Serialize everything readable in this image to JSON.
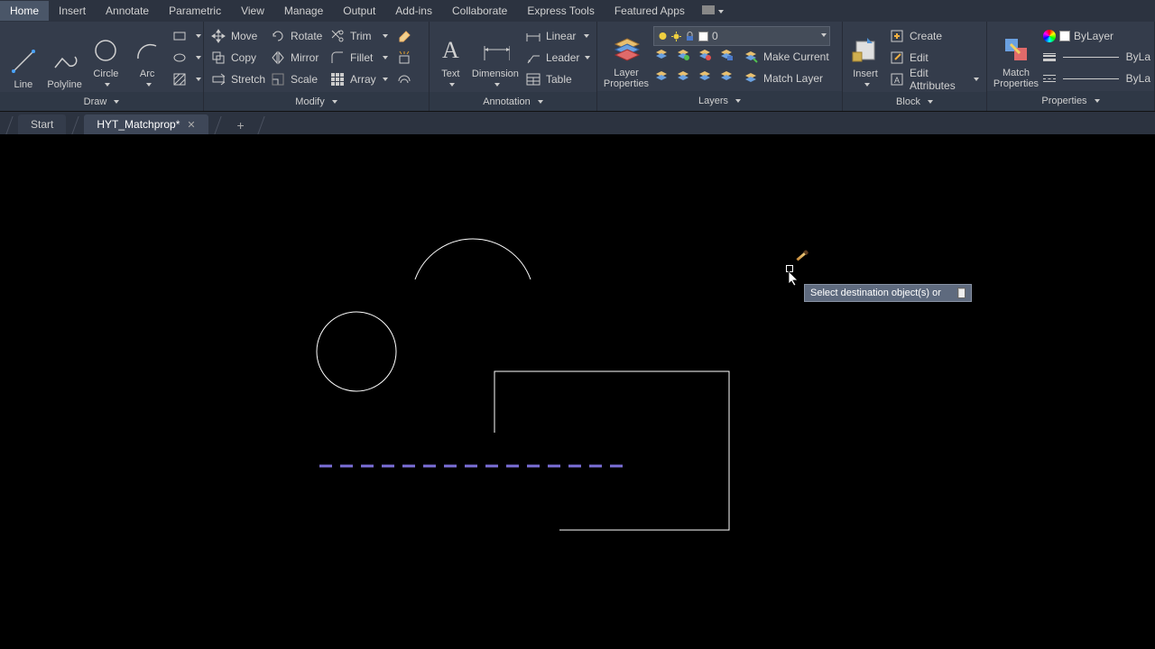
{
  "menu": {
    "tabs": [
      "Home",
      "Insert",
      "Annotate",
      "Parametric",
      "View",
      "Manage",
      "Output",
      "Add-ins",
      "Collaborate",
      "Express Tools",
      "Featured Apps"
    ]
  },
  "ribbon": {
    "draw": {
      "title": "Draw",
      "big": [
        "Line",
        "Polyline",
        "Circle",
        "Arc"
      ]
    },
    "modify": {
      "title": "Modify",
      "items": [
        [
          "Move",
          "Rotate",
          "Trim"
        ],
        [
          "Copy",
          "Mirror",
          "Fillet"
        ],
        [
          "Stretch",
          "Scale",
          "Array"
        ]
      ]
    },
    "annotation": {
      "title": "Annotation",
      "big": [
        "Text",
        "Dimension"
      ],
      "items": [
        "Linear",
        "Leader",
        "Table"
      ]
    },
    "layers": {
      "title": "Layers",
      "big": "Layer\nProperties",
      "current": "Make Current",
      "match": "Match Layer",
      "layer_name": "0"
    },
    "block": {
      "title": "Block",
      "big": "Insert",
      "items": [
        "Create",
        "Edit",
        "Edit Attributes"
      ]
    },
    "properties": {
      "title": "Properties",
      "big": "Match\nProperties",
      "bylayer": "ByLayer",
      "byla": "ByLa"
    }
  },
  "doctabs": {
    "start": "Start",
    "file": "HYT_Matchprop*"
  },
  "tooltip": "Select destination object(s) or"
}
